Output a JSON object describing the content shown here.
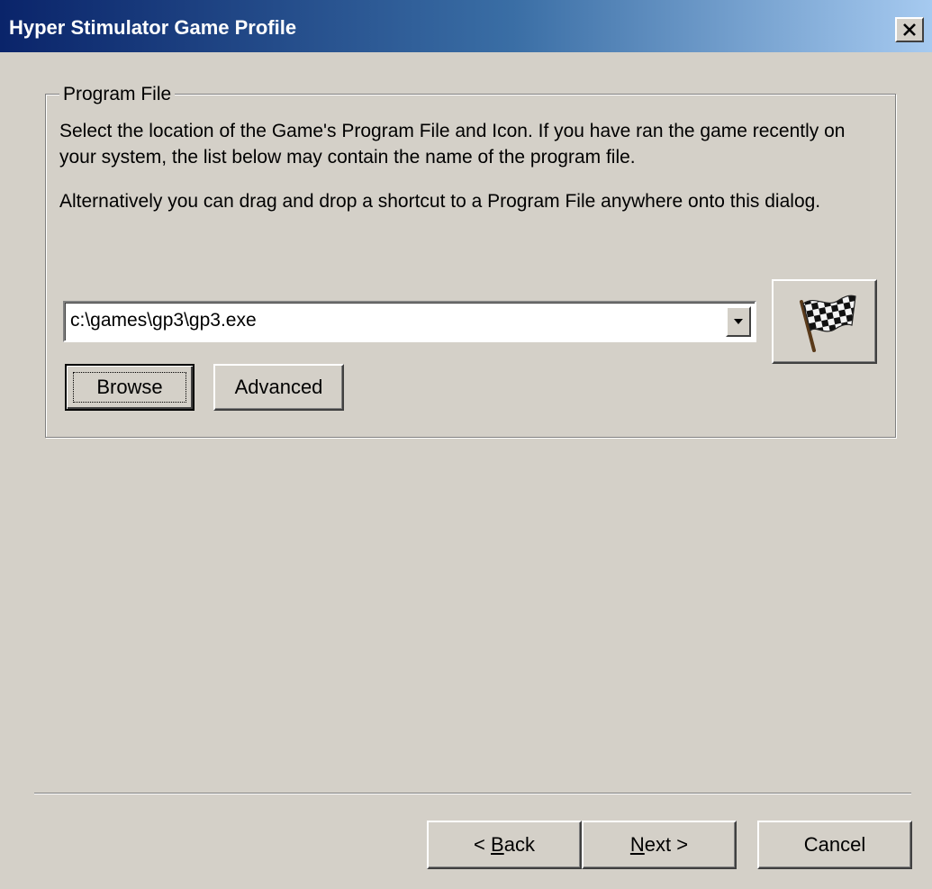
{
  "window": {
    "title": "Hyper Stimulator Game Profile",
    "close_symbol": "×"
  },
  "group": {
    "legend": "Program File",
    "description_1": "Select the location of the Game's Program File and Icon. If you have ran the game recently on your system, the list below may contain the name of the program file.",
    "description_2": "Alternatively you can drag and drop a shortcut to a Program File anywhere onto this dialog.",
    "program_path": {
      "value": "c:\\games\\gp3\\gp3.exe"
    },
    "icon": "checkered-flag-icon",
    "browse_label": "Browse",
    "advanced_label": "Advanced"
  },
  "footer": {
    "back_prefix": "< ",
    "back_hotkey": "B",
    "back_rest": "ack",
    "next_hotkey": "N",
    "next_rest": "ext >",
    "cancel_label": "Cancel"
  },
  "colors": {
    "titlebar_start": "#0a246a",
    "titlebar_end": "#a6caf0",
    "face": "#d4d0c8"
  }
}
